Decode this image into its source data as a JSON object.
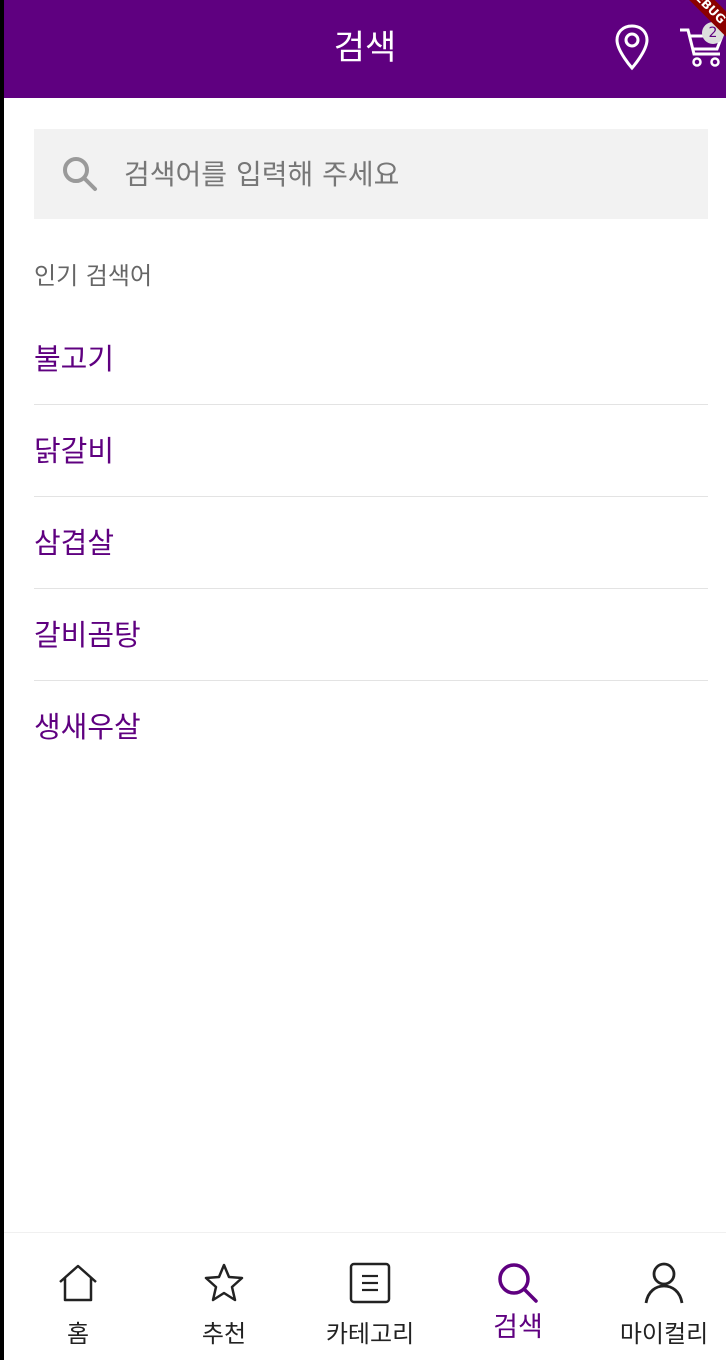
{
  "app_bar": {
    "title": "검색",
    "location_icon": "location-pin-icon",
    "cart_icon": "cart-icon",
    "cart_count": "2",
    "debug_label": "DEBUG"
  },
  "search": {
    "placeholder": "검색어를 입력해 주세요",
    "icon": "search-icon"
  },
  "popular": {
    "label": "인기 검색어",
    "items": [
      "불고기",
      "닭갈비",
      "삼겹살",
      "갈비곰탕",
      "생새우살"
    ]
  },
  "bottom_nav": {
    "items": [
      {
        "label": "홈",
        "icon": "home-icon"
      },
      {
        "label": "추천",
        "icon": "star-icon"
      },
      {
        "label": "카테고리",
        "icon": "category-list-icon"
      },
      {
        "label": "검색",
        "icon": "search-icon",
        "active": true
      },
      {
        "label": "마이컬리",
        "icon": "person-icon"
      }
    ]
  },
  "colors": {
    "brand": "#5f0080",
    "search_bg": "#f2f2f2"
  }
}
